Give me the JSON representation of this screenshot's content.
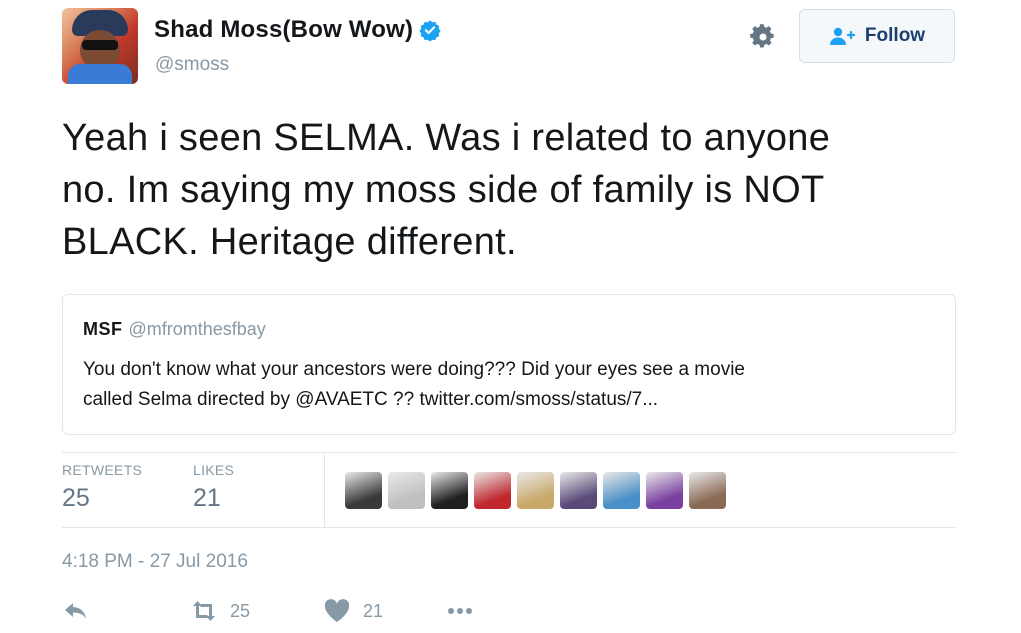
{
  "author": {
    "display_name": "Shad Moss(Bow Wow)",
    "handle": "@smoss",
    "verified": true,
    "avatar_icon": "avatar"
  },
  "header": {
    "follow_label": "Follow",
    "gear_icon": "gear-icon",
    "follow_icon": "add-user-icon"
  },
  "tweet": {
    "line1": "Yeah i seen SELMA. Was i related to anyone",
    "line2": "no. Im saying my moss side of family is NOT",
    "line3": "BLACK. Heritage different."
  },
  "quoted": {
    "name": "MSF",
    "handle": "@mfromthesfbay",
    "line1": "You don't know what your ancestors were doing??? Did your eyes see a movie",
    "line2": "called Selma directed by @AVAETC ?? twitter.com/smoss/status/7..."
  },
  "stats": {
    "retweets_label": "RETWEETS",
    "retweets_value": "25",
    "likes_label": "LIKES",
    "likes_value": "21"
  },
  "likers_colors": [
    "#3a3a3a",
    "#bfbfbf",
    "#1f1f1f",
    "#c0282d",
    "#c9a86a",
    "#5a4a7a",
    "#4a90c8",
    "#7b3fa0",
    "#8a6a55"
  ],
  "timestamp": "4:18 PM - 27 Jul 2016",
  "actions": {
    "reply_icon": "reply-icon",
    "retweet_icon": "retweet-icon",
    "retweet_count": "25",
    "like_icon": "heart-icon",
    "like_count": "21",
    "more_icon": "more-icon"
  },
  "colors": {
    "text": "#14171a",
    "muted": "#8899a6",
    "verified": "#1da1f2",
    "border": "#e1e8ed"
  }
}
